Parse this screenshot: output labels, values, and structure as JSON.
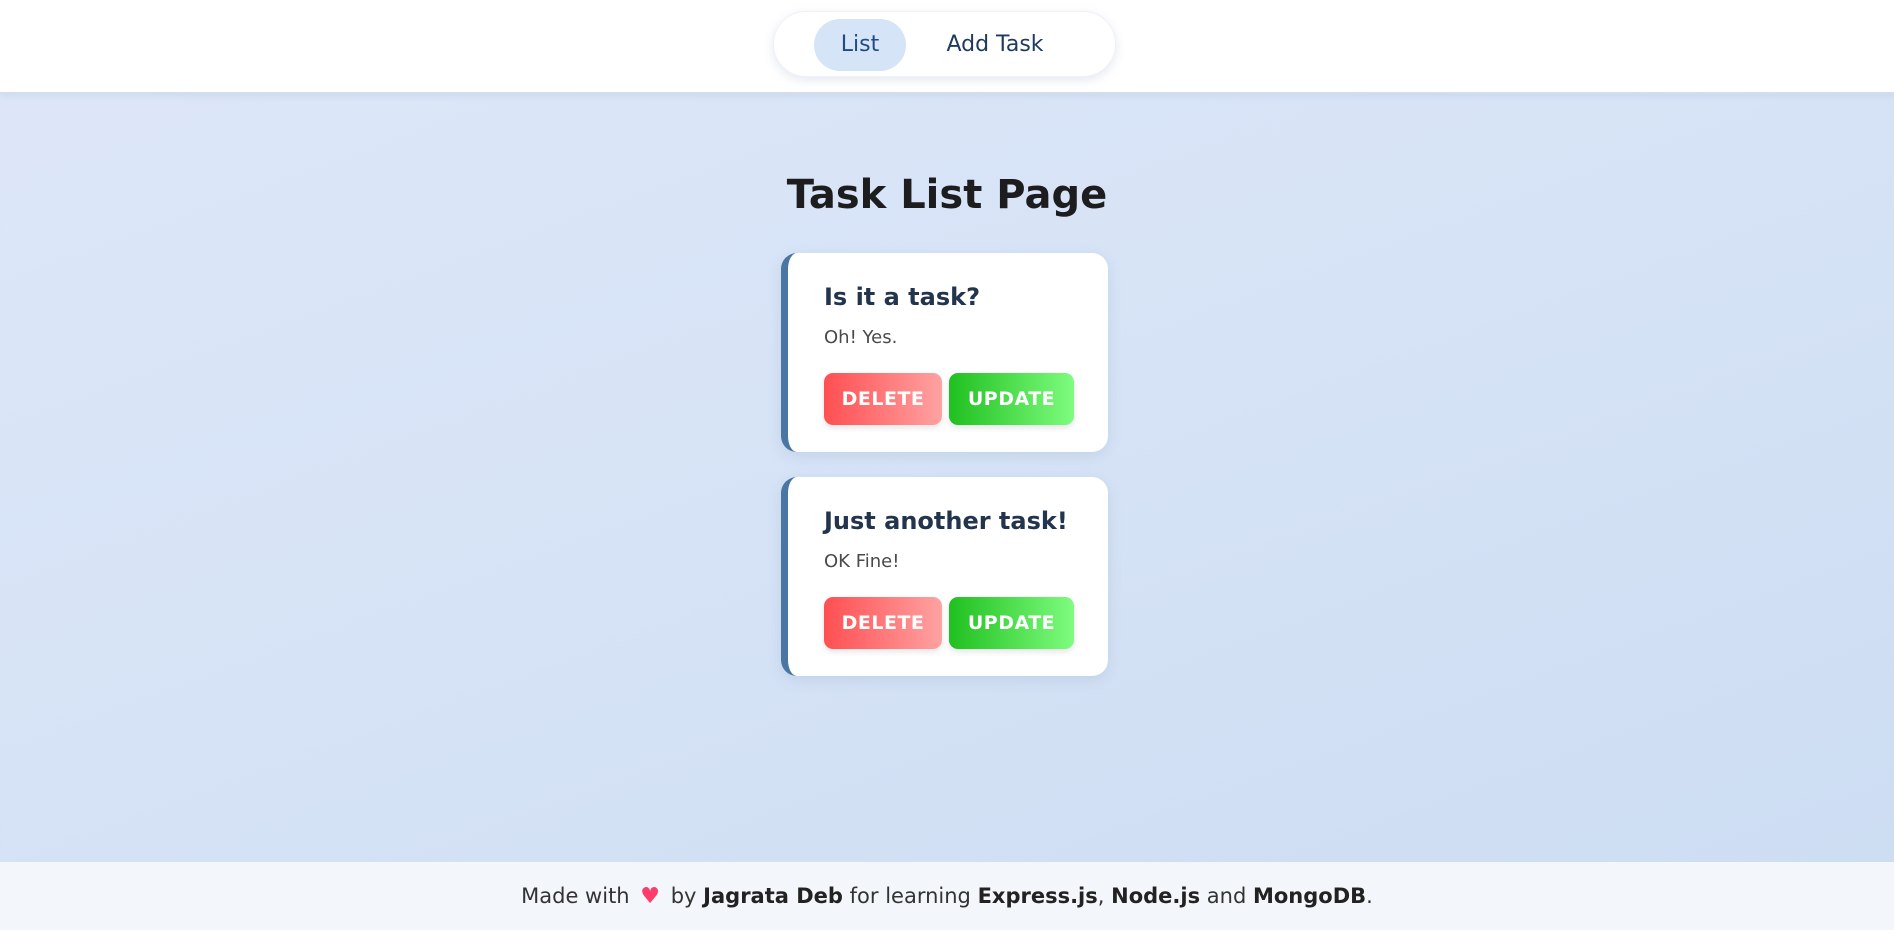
{
  "nav": {
    "list_label": "List",
    "add_label": "Add Task"
  },
  "page": {
    "title": "Task List Page"
  },
  "tasks": [
    {
      "title": "Is it a task?",
      "description": "Oh! Yes.",
      "delete_label": "DELETE",
      "update_label": "UPDATE"
    },
    {
      "title": "Just another task!",
      "description": "OK Fine!",
      "delete_label": "DELETE",
      "update_label": "UPDATE"
    }
  ],
  "footer": {
    "made_with": "Made with",
    "heart_icon": "heart-icon",
    "by": "by",
    "author": "Jagrata Deb",
    "for_learning": "for learning",
    "tech1": "Express.js",
    "sep1": ",",
    "tech2": "Node.js",
    "and": "and",
    "tech3": "MongoDB",
    "end": "."
  },
  "colors": {
    "accent_border": "#4a76a3",
    "delete_start": "#ff4f52",
    "update_start": "#20c020",
    "active_nav_bg": "#d6e4f7"
  }
}
